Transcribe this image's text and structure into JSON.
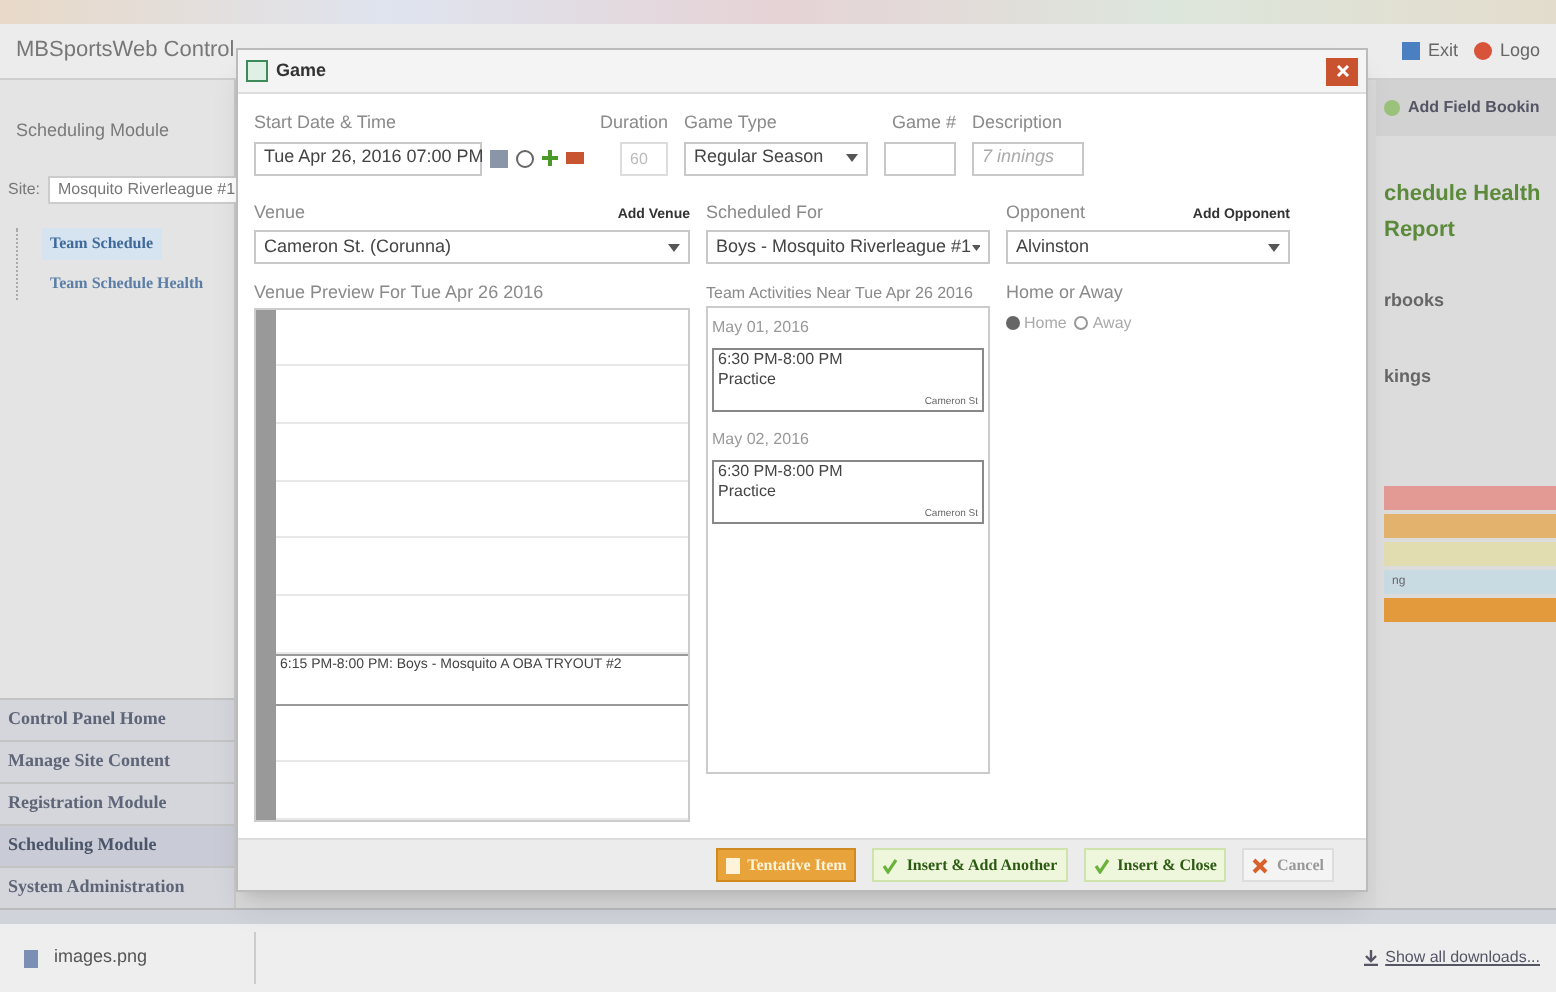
{
  "app": {
    "title": "MBSportsWeb Control",
    "header_links": [
      "Exit",
      "Logo"
    ]
  },
  "sidebar": {
    "module_title": "Scheduling Module",
    "site_label": "Site:",
    "site_value": "Mosquito Riverleague #1",
    "tree": [
      {
        "label": "Team Schedule",
        "selected": true
      },
      {
        "label": "Team Schedule Health",
        "selected": false
      }
    ],
    "nav": [
      {
        "label": "Control Panel Home",
        "selected": false
      },
      {
        "label": "Manage Site Content",
        "selected": false
      },
      {
        "label": "Registration Module",
        "selected": false
      },
      {
        "label": "Scheduling Module",
        "selected": true
      },
      {
        "label": "System Administration",
        "selected": false
      }
    ]
  },
  "right_panel": {
    "add_button": "Add Field Bookin",
    "heading": [
      "chedule Health",
      "Report"
    ],
    "links": [
      "rbooks",
      "kings"
    ],
    "bars": [
      {
        "color": "#e49a94"
      },
      {
        "color": "#e3b36e"
      },
      {
        "color": "#e2ddb0"
      },
      {
        "color": "#c9dbe2",
        "label": "ng"
      },
      {
        "color": "#e29a3c"
      }
    ]
  },
  "dialog": {
    "title": "Game",
    "start": {
      "label": "Start Date & Time",
      "value": "Tue Apr 26, 2016 07:00 PM"
    },
    "duration": {
      "label": "Duration",
      "placeholder": "60"
    },
    "game_type": {
      "label": "Game Type",
      "value": "Regular Season"
    },
    "game_number": {
      "label": "Game #"
    },
    "description": {
      "label": "Description",
      "placeholder": "7 innings"
    },
    "venue": {
      "label": "Venue",
      "action": "Add Venue",
      "value": "Cameron St. (Corunna)"
    },
    "scheduled_for": {
      "label": "Scheduled For",
      "value": "Boys - Mosquito Riverleague #1"
    },
    "opponent": {
      "label": "Opponent",
      "action": "Add Opponent",
      "value": "Alvinston"
    },
    "venue_preview": {
      "title": "Venue Preview For Tue Apr 26 2016",
      "event": "6:15 PM-8:00 PM: Boys - Mosquito A OBA TRYOUT #2"
    },
    "team_activities": {
      "title": "Team Activities Near Tue Apr 26 2016",
      "days": [
        {
          "date": "May 01, 2016",
          "time": "6:30 PM-8:00 PM",
          "name": "Practice",
          "venue": "Cameron St"
        },
        {
          "date": "May 02, 2016",
          "time": "6:30 PM-8:00 PM",
          "name": "Practice",
          "venue": "Cameron St"
        }
      ]
    },
    "home_or_away": {
      "label": "Home or Away",
      "options": [
        {
          "label": "Home",
          "selected": true
        },
        {
          "label": "Away",
          "selected": false
        }
      ]
    },
    "buttons": [
      {
        "kind": "tentative",
        "label": "Tentative Item"
      },
      {
        "kind": "insert",
        "label": "Insert & Add Another"
      },
      {
        "kind": "insert",
        "label": "Insert & Close"
      },
      {
        "kind": "cancel",
        "label": "Cancel"
      }
    ]
  },
  "downloads": {
    "file": "images.png",
    "show_all": "Show all downloads..."
  }
}
